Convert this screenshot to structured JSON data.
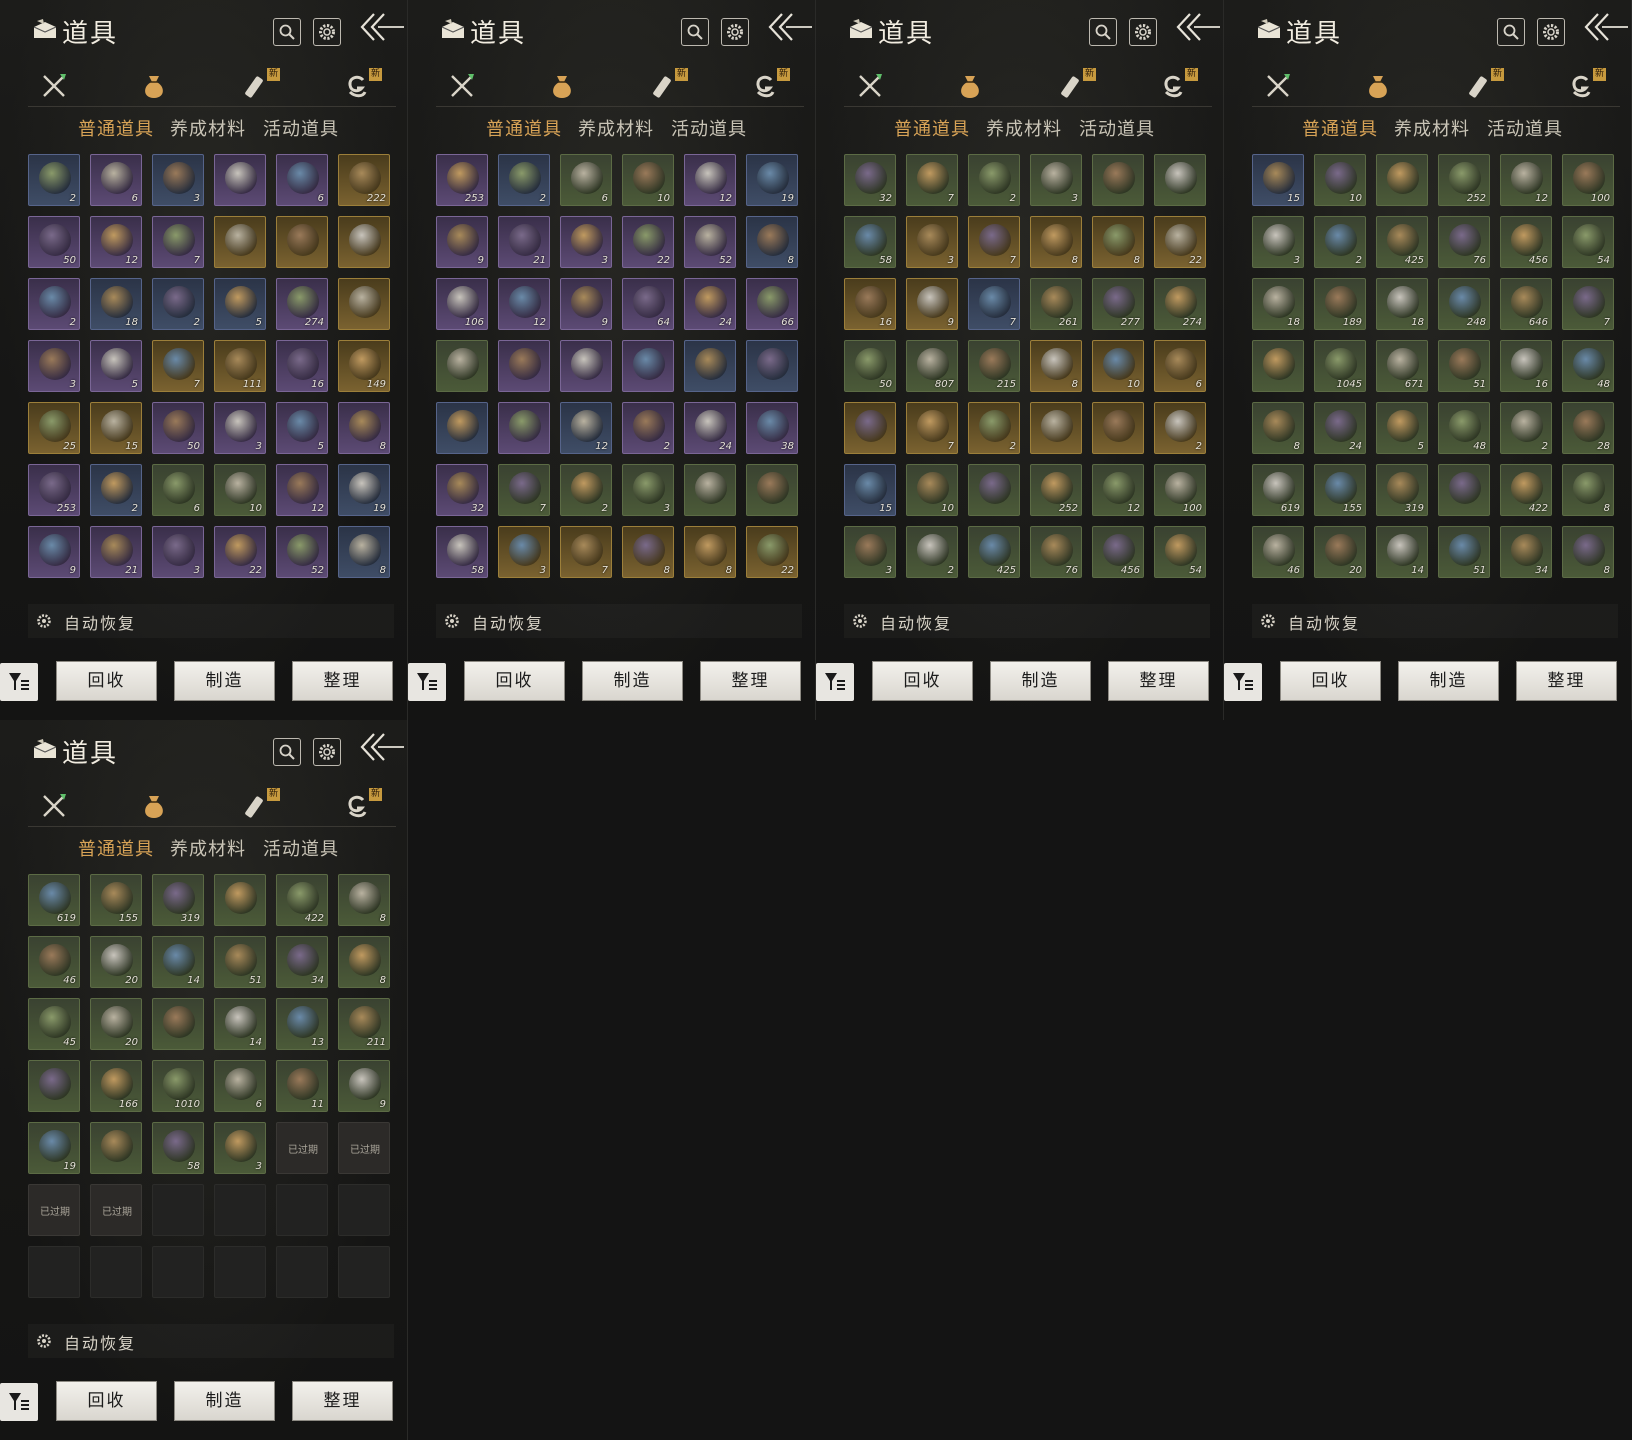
{
  "colors": {
    "rarity_common": "#4b5a38",
    "rarity_fine": "#3f4d66",
    "rarity_rare": "#5c4a74",
    "rarity_epic": "#7a6230",
    "active_tab": "#d8a356"
  },
  "panel": {
    "title": "道具",
    "title_icon": "item-box-icon",
    "search_icon": "search-icon",
    "settings_icon": "gear-icon",
    "back_icon": "back-arrow-icon",
    "categories": [
      {
        "icon": "weapon-icon",
        "badge": ""
      },
      {
        "icon": "pouch-icon",
        "badge": "",
        "active": true
      },
      {
        "icon": "scroll-icon",
        "badge": "新"
      },
      {
        "icon": "token-icon",
        "badge": "新"
      }
    ],
    "subtabs": [
      {
        "label": "普通道具",
        "active": true
      },
      {
        "label": "养成材料",
        "active": false
      },
      {
        "label": "活动道具",
        "active": false
      }
    ],
    "auto_restore": "自动恢复",
    "filter_icon": "filter-icon",
    "buttons": {
      "recycle": "回收",
      "craft": "制造",
      "sort": "整理"
    }
  },
  "screens": [
    {
      "rows": [
        [
          {
            "r": "1",
            "q": "2"
          },
          {
            "r": "2",
            "q": "6"
          },
          {
            "r": "1",
            "q": "3"
          },
          {
            "r": "2",
            "q": ""
          },
          {
            "r": "2",
            "q": "6"
          },
          {
            "r": "3",
            "q": "222"
          }
        ],
        [
          {
            "r": "2",
            "q": "50"
          },
          {
            "r": "2",
            "q": "12"
          },
          {
            "r": "2",
            "q": "7"
          },
          {
            "r": "3",
            "q": ""
          },
          {
            "r": "3",
            "q": ""
          },
          {
            "r": "3",
            "q": ""
          }
        ],
        [
          {
            "r": "2",
            "q": "2"
          },
          {
            "r": "1",
            "q": "18"
          },
          {
            "r": "1",
            "q": "2"
          },
          {
            "r": "1",
            "q": "5"
          },
          {
            "r": "2",
            "q": "274"
          },
          {
            "r": "3",
            "q": ""
          }
        ],
        [
          {
            "r": "2",
            "q": "3"
          },
          {
            "r": "2",
            "q": "5"
          },
          {
            "r": "3",
            "q": "7"
          },
          {
            "r": "3",
            "q": "111"
          },
          {
            "r": "2",
            "q": "16"
          },
          {
            "r": "3",
            "q": "149"
          }
        ],
        [
          {
            "r": "3",
            "q": "25"
          },
          {
            "r": "3",
            "q": "15"
          },
          {
            "r": "2",
            "q": "50"
          },
          {
            "r": "2",
            "q": "3"
          },
          {
            "r": "2",
            "q": "5"
          },
          {
            "r": "2",
            "q": "8"
          }
        ],
        [
          {
            "r": "2",
            "q": "253"
          },
          {
            "r": "1",
            "q": "2"
          },
          {
            "r": "0",
            "q": "6"
          },
          {
            "r": "0",
            "q": "10"
          },
          {
            "r": "2",
            "q": "12"
          },
          {
            "r": "1",
            "q": "19"
          }
        ],
        [
          {
            "r": "2",
            "q": "9"
          },
          {
            "r": "2",
            "q": "21"
          },
          {
            "r": "2",
            "q": "3"
          },
          {
            "r": "2",
            "q": "22"
          },
          {
            "r": "2",
            "q": "52"
          },
          {
            "r": "1",
            "q": "8"
          }
        ]
      ]
    },
    {
      "rows": [
        [
          {
            "r": "2",
            "q": "253"
          },
          {
            "r": "1",
            "q": "2"
          },
          {
            "r": "0",
            "q": "6"
          },
          {
            "r": "0",
            "q": "10"
          },
          {
            "r": "2",
            "q": "12"
          },
          {
            "r": "1",
            "q": "19"
          }
        ],
        [
          {
            "r": "2",
            "q": "9"
          },
          {
            "r": "2",
            "q": "21"
          },
          {
            "r": "2",
            "q": "3"
          },
          {
            "r": "2",
            "q": "22"
          },
          {
            "r": "2",
            "q": "52"
          },
          {
            "r": "1",
            "q": "8"
          }
        ],
        [
          {
            "r": "2",
            "q": "106"
          },
          {
            "r": "2",
            "q": "12"
          },
          {
            "r": "2",
            "q": "9"
          },
          {
            "r": "2",
            "q": "64"
          },
          {
            "r": "2",
            "q": "24"
          },
          {
            "r": "2",
            "q": "66"
          }
        ],
        [
          {
            "r": "0",
            "q": ""
          },
          {
            "r": "2",
            "q": ""
          },
          {
            "r": "2",
            "q": ""
          },
          {
            "r": "2",
            "q": ""
          },
          {
            "r": "1",
            "q": ""
          },
          {
            "r": "1",
            "q": ""
          }
        ],
        [
          {
            "r": "1",
            "q": ""
          },
          {
            "r": "2",
            "q": ""
          },
          {
            "r": "1",
            "q": "12"
          },
          {
            "r": "2",
            "q": "2"
          },
          {
            "r": "2",
            "q": "24"
          },
          {
            "r": "2",
            "q": "38"
          }
        ],
        [
          {
            "r": "2",
            "q": "32"
          },
          {
            "r": "0",
            "q": "7"
          },
          {
            "r": "0",
            "q": "2"
          },
          {
            "r": "0",
            "q": "3"
          },
          {
            "r": "0",
            "q": ""
          },
          {
            "r": "0",
            "q": ""
          }
        ],
        [
          {
            "r": "2",
            "q": "58"
          },
          {
            "r": "3",
            "q": "3"
          },
          {
            "r": "3",
            "q": "7"
          },
          {
            "r": "3",
            "q": "8"
          },
          {
            "r": "3",
            "q": "8"
          },
          {
            "r": "3",
            "q": "22"
          }
        ]
      ]
    },
    {
      "rows": [
        [
          {
            "r": "0",
            "q": "32"
          },
          {
            "r": "0",
            "q": "7"
          },
          {
            "r": "0",
            "q": "2"
          },
          {
            "r": "0",
            "q": "3"
          },
          {
            "r": "0",
            "q": ""
          },
          {
            "r": "0",
            "q": ""
          }
        ],
        [
          {
            "r": "0",
            "q": "58"
          },
          {
            "r": "3",
            "q": "3"
          },
          {
            "r": "3",
            "q": "7"
          },
          {
            "r": "3",
            "q": "8"
          },
          {
            "r": "3",
            "q": "8"
          },
          {
            "r": "3",
            "q": "22"
          }
        ],
        [
          {
            "r": "3",
            "q": "16"
          },
          {
            "r": "3",
            "q": "9"
          },
          {
            "r": "1",
            "q": "7"
          },
          {
            "r": "0",
            "q": "261"
          },
          {
            "r": "0",
            "q": "277"
          },
          {
            "r": "0",
            "q": "274"
          }
        ],
        [
          {
            "r": "0",
            "q": "50"
          },
          {
            "r": "0",
            "q": "807"
          },
          {
            "r": "0",
            "q": "215"
          },
          {
            "r": "3",
            "q": "8"
          },
          {
            "r": "3",
            "q": "10"
          },
          {
            "r": "3",
            "q": "6"
          }
        ],
        [
          {
            "r": "3",
            "q": ""
          },
          {
            "r": "3",
            "q": "7"
          },
          {
            "r": "3",
            "q": "2"
          },
          {
            "r": "3",
            "q": ""
          },
          {
            "r": "3",
            "q": ""
          },
          {
            "r": "3",
            "q": "2"
          }
        ],
        [
          {
            "r": "1",
            "q": "15"
          },
          {
            "r": "0",
            "q": "10"
          },
          {
            "r": "0",
            "q": ""
          },
          {
            "r": "0",
            "q": "252"
          },
          {
            "r": "0",
            "q": "12"
          },
          {
            "r": "0",
            "q": "100"
          }
        ],
        [
          {
            "r": "0",
            "q": "3"
          },
          {
            "r": "0",
            "q": "2"
          },
          {
            "r": "0",
            "q": "425"
          },
          {
            "r": "0",
            "q": "76"
          },
          {
            "r": "0",
            "q": "456"
          },
          {
            "r": "0",
            "q": "54"
          }
        ]
      ]
    },
    {
      "rows": [
        [
          {
            "r": "1",
            "q": "15"
          },
          {
            "r": "0",
            "q": "10"
          },
          {
            "r": "0",
            "q": ""
          },
          {
            "r": "0",
            "q": "252"
          },
          {
            "r": "0",
            "q": "12"
          },
          {
            "r": "0",
            "q": "100"
          }
        ],
        [
          {
            "r": "0",
            "q": "3"
          },
          {
            "r": "0",
            "q": "2"
          },
          {
            "r": "0",
            "q": "425"
          },
          {
            "r": "0",
            "q": "76"
          },
          {
            "r": "0",
            "q": "456"
          },
          {
            "r": "0",
            "q": "54"
          }
        ],
        [
          {
            "r": "0",
            "q": "18"
          },
          {
            "r": "0",
            "q": "189"
          },
          {
            "r": "0",
            "q": "18"
          },
          {
            "r": "0",
            "q": "248"
          },
          {
            "r": "0",
            "q": "646"
          },
          {
            "r": "0",
            "q": "7"
          }
        ],
        [
          {
            "r": "0",
            "q": ""
          },
          {
            "r": "0",
            "q": "1045"
          },
          {
            "r": "0",
            "q": "671"
          },
          {
            "r": "0",
            "q": "51"
          },
          {
            "r": "0",
            "q": "16"
          },
          {
            "r": "0",
            "q": "48"
          }
        ],
        [
          {
            "r": "0",
            "q": "8"
          },
          {
            "r": "0",
            "q": "24"
          },
          {
            "r": "0",
            "q": "5"
          },
          {
            "r": "0",
            "q": "48"
          },
          {
            "r": "0",
            "q": "2"
          },
          {
            "r": "0",
            "q": "28"
          }
        ],
        [
          {
            "r": "0",
            "q": "619"
          },
          {
            "r": "0",
            "q": "155"
          },
          {
            "r": "0",
            "q": "319"
          },
          {
            "r": "0",
            "q": ""
          },
          {
            "r": "0",
            "q": "422"
          },
          {
            "r": "0",
            "q": "8"
          }
        ],
        [
          {
            "r": "0",
            "q": "46"
          },
          {
            "r": "0",
            "q": "20"
          },
          {
            "r": "0",
            "q": "14"
          },
          {
            "r": "0",
            "q": "51"
          },
          {
            "r": "0",
            "q": "34"
          },
          {
            "r": "0",
            "q": "8"
          }
        ]
      ]
    },
    {
      "rows": [
        [
          {
            "r": "0",
            "q": "619"
          },
          {
            "r": "0",
            "q": "155"
          },
          {
            "r": "0",
            "q": "319"
          },
          {
            "r": "0",
            "q": ""
          },
          {
            "r": "0",
            "q": "422"
          },
          {
            "r": "0",
            "q": "8"
          }
        ],
        [
          {
            "r": "0",
            "q": "46"
          },
          {
            "r": "0",
            "q": "20"
          },
          {
            "r": "0",
            "q": "14"
          },
          {
            "r": "0",
            "q": "51"
          },
          {
            "r": "0",
            "q": "34"
          },
          {
            "r": "0",
            "q": "8"
          }
        ],
        [
          {
            "r": "0",
            "q": "45"
          },
          {
            "r": "0",
            "q": "20"
          },
          {
            "r": "0",
            "q": ""
          },
          {
            "r": "0",
            "q": "14"
          },
          {
            "r": "0",
            "q": "13"
          },
          {
            "r": "0",
            "q": "211"
          }
        ],
        [
          {
            "r": "0",
            "q": ""
          },
          {
            "r": "0",
            "q": "166"
          },
          {
            "r": "0",
            "q": "1010"
          },
          {
            "r": "0",
            "q": "6"
          },
          {
            "r": "0",
            "q": "11"
          },
          {
            "r": "0",
            "q": "9"
          }
        ],
        [
          {
            "r": "0",
            "q": "19"
          },
          {
            "r": "0",
            "q": ""
          },
          {
            "r": "0",
            "q": "58"
          },
          {
            "r": "0",
            "q": "3"
          },
          {
            "x": "已过期",
            "q": ""
          },
          {
            "x": "已过期",
            "q": ""
          }
        ],
        [
          {
            "x": "已过期",
            "q": ""
          },
          {
            "x": "已过期",
            "q": ""
          },
          {
            "e": true
          },
          {
            "e": true
          },
          {
            "e": true
          },
          {
            "e": true
          }
        ],
        [
          {
            "e": true
          },
          {
            "e": true
          },
          {
            "e": true
          },
          {
            "e": true
          },
          {
            "e": true
          },
          {
            "e": true
          }
        ]
      ]
    }
  ]
}
